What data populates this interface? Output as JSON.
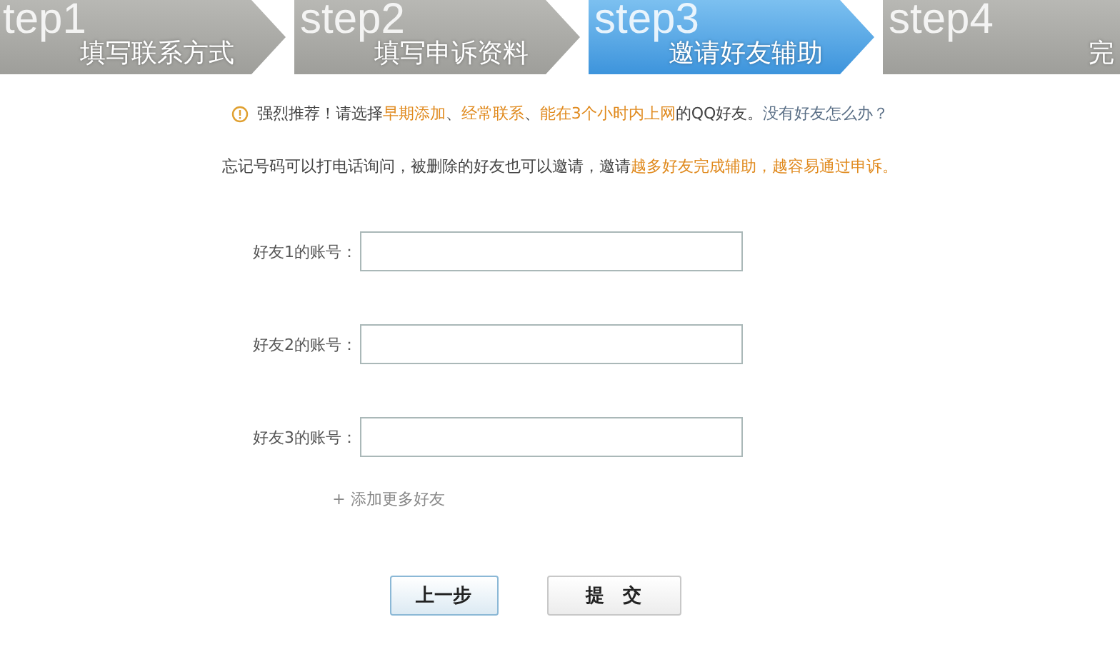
{
  "steps": [
    {
      "number": "tep1",
      "label": "填写联系方式",
      "selected": false
    },
    {
      "number": "step2",
      "label": "填写申诉资料",
      "selected": false
    },
    {
      "number": "step3",
      "label": "邀请好友辅助",
      "selected": true
    },
    {
      "number": "step4",
      "label": "完",
      "selected": false
    }
  ],
  "notices": [
    {
      "icon": true,
      "segments": [
        {
          "kind": "text",
          "text": "强烈推荐！请选择"
        },
        {
          "kind": "highlight",
          "text": "早期添加"
        },
        {
          "kind": "text",
          "text": "、"
        },
        {
          "kind": "highlight",
          "text": "经常联系"
        },
        {
          "kind": "text",
          "text": "、"
        },
        {
          "kind": "highlight",
          "text": "能在3个小时内上网"
        },
        {
          "kind": "text",
          "text": "的QQ好友。"
        },
        {
          "kind": "link",
          "text": "没有好友怎么办？"
        }
      ]
    },
    {
      "icon": false,
      "segments": [
        {
          "kind": "text",
          "text": "忘记号码可以打电话询问，被删除的好友也可以邀请，邀请"
        },
        {
          "kind": "highlight",
          "text": "越多好友完成辅助，越容易通过申诉。"
        }
      ]
    }
  ],
  "fields": [
    {
      "label": "好友1的账号："
    },
    {
      "label": "好友2的账号："
    },
    {
      "label": "好友3的账号："
    }
  ],
  "add_more": "+ 添加更多好友",
  "buttons": [
    {
      "label": "上一步",
      "kind": "secondary"
    },
    {
      "label": "提　交",
      "kind": "primary"
    }
  ]
}
